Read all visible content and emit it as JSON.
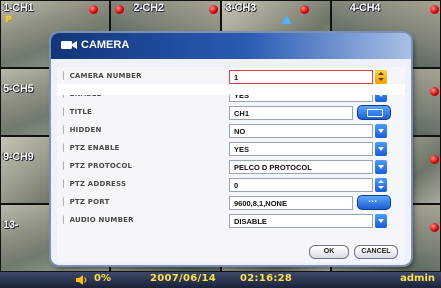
{
  "channels": [
    {
      "label": "1-CH1",
      "rec": true,
      "badge": "P"
    },
    {
      "label": "2-CH2",
      "rec": true
    },
    {
      "label": "3-CH3",
      "rec": true
    },
    {
      "label": "4-CH4",
      "rec": true
    },
    {
      "label": "5-CH5",
      "rec": true
    },
    {
      "label": "",
      "rec": false
    },
    {
      "label": "",
      "rec": false
    },
    {
      "label": "",
      "rec": true
    },
    {
      "label": "9-CH9",
      "rec": true
    },
    {
      "label": "",
      "rec": false
    },
    {
      "label": "",
      "rec": false
    },
    {
      "label": "",
      "rec": true
    },
    {
      "label": "13-",
      "rec": true
    },
    {
      "label": "",
      "rec": false
    },
    {
      "label": "",
      "rec": false
    },
    {
      "label": "",
      "rec": true
    }
  ],
  "dialog": {
    "title": "CAMERA",
    "rows": [
      {
        "label": "CAMERA NUMBER",
        "value": "1"
      },
      {
        "label": "ENABLE",
        "value": "YES"
      },
      {
        "label": "TITLE",
        "value": "CH1"
      },
      {
        "label": "HIDDEN",
        "value": "NO"
      },
      {
        "label": "PTZ ENABLE",
        "value": "YES"
      },
      {
        "label": "PTZ PROTOCOL",
        "value": "PELCO D PROTOCOL"
      },
      {
        "label": "PTZ ADDRESS",
        "value": "0"
      },
      {
        "label": "PTZ PORT",
        "value": "9600,8,1,NONE"
      },
      {
        "label": "AUDIO NUMBER",
        "value": "DISABLE"
      }
    ],
    "ok_label": "OK",
    "cancel_label": "CANCEL"
  },
  "statusbar": {
    "volume": "0%",
    "date": "2007/06/14",
    "time": "02:16:28",
    "user": "admin"
  },
  "colors": {
    "dialog_header": "#1a3f8a",
    "accent": "#1a5ed8",
    "status_text": "#ffe04a",
    "record": "#d10000"
  }
}
